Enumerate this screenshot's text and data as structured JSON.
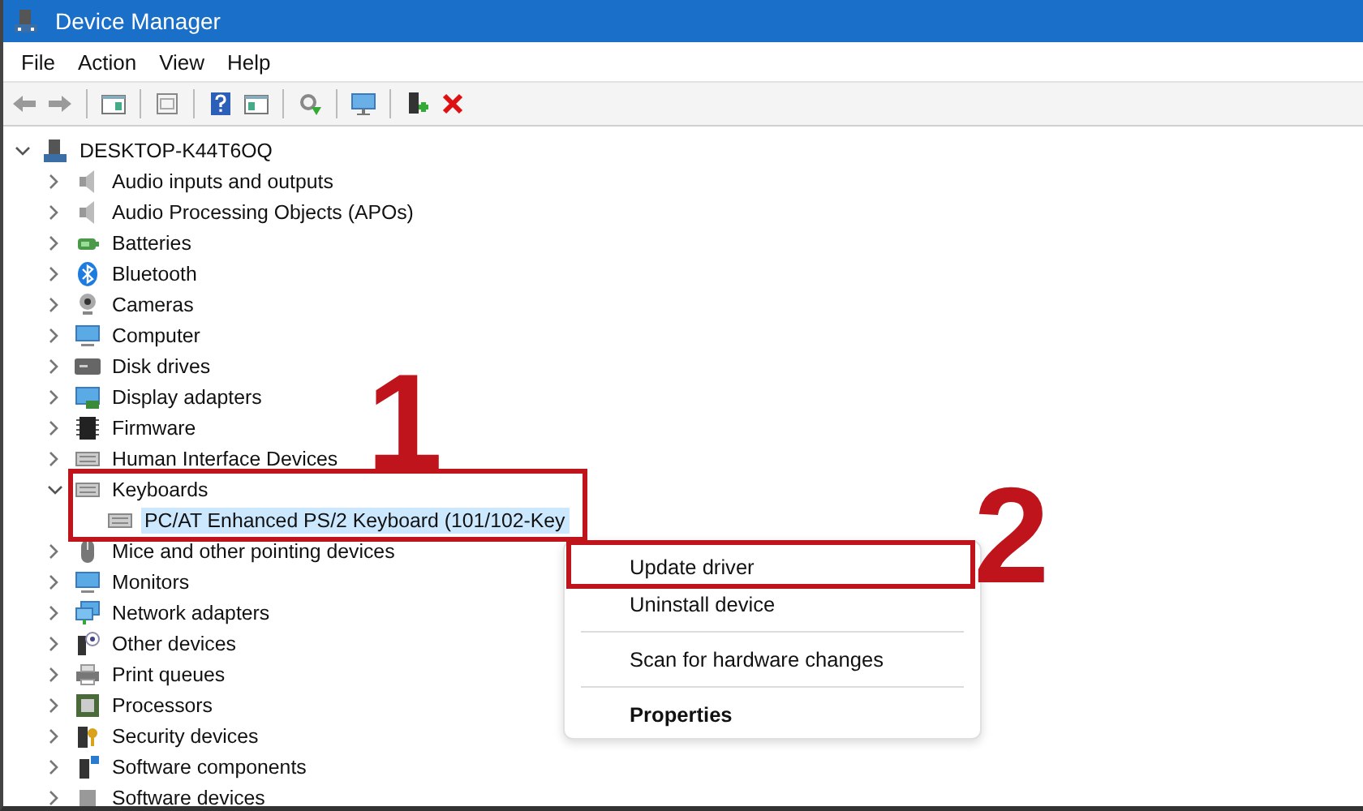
{
  "window": {
    "title": "Device Manager"
  },
  "menu": [
    "File",
    "Action",
    "View",
    "Help"
  ],
  "tree": {
    "label": "DESKTOP-K44T6OQ",
    "expanded": true,
    "selected": false,
    "children": [
      {
        "label": "Audio inputs and outputs",
        "expanded": false,
        "selected": false
      },
      {
        "label": "Audio Processing Objects (APOs)",
        "expanded": false,
        "selected": false
      },
      {
        "label": "Batteries",
        "expanded": false,
        "selected": false
      },
      {
        "label": "Bluetooth",
        "expanded": false,
        "selected": false
      },
      {
        "label": "Cameras",
        "expanded": false,
        "selected": false
      },
      {
        "label": "Computer",
        "expanded": false,
        "selected": false
      },
      {
        "label": "Disk drives",
        "expanded": false,
        "selected": false
      },
      {
        "label": "Display adapters",
        "expanded": false,
        "selected": false
      },
      {
        "label": "Firmware",
        "expanded": false,
        "selected": false
      },
      {
        "label": "Human Interface Devices",
        "expanded": false,
        "selected": false
      },
      {
        "label": "Keyboards",
        "expanded": true,
        "selected": false,
        "children": [
          {
            "label": "PC/AT Enhanced PS/2 Keyboard (101/102-Key",
            "selected": true
          }
        ]
      },
      {
        "label": "Mice and other pointing devices",
        "expanded": false,
        "selected": false
      },
      {
        "label": "Monitors",
        "expanded": false,
        "selected": false
      },
      {
        "label": "Network adapters",
        "expanded": false,
        "selected": false
      },
      {
        "label": "Other devices",
        "expanded": false,
        "selected": false
      },
      {
        "label": "Print queues",
        "expanded": false,
        "selected": false
      },
      {
        "label": "Processors",
        "expanded": false,
        "selected": false
      },
      {
        "label": "Security devices",
        "expanded": false,
        "selected": false
      },
      {
        "label": "Software components",
        "expanded": false,
        "selected": false
      },
      {
        "label": "Software devices",
        "expanded": false,
        "selected": false
      }
    ]
  },
  "context_menu": {
    "items": [
      {
        "kind": "item",
        "label": "Update driver"
      },
      {
        "kind": "item",
        "label": "Uninstall device"
      },
      {
        "kind": "separator"
      },
      {
        "kind": "item",
        "label": "Scan for hardware changes"
      },
      {
        "kind": "separator"
      },
      {
        "kind": "default",
        "label": "Properties"
      }
    ]
  },
  "annotations": [
    {
      "label": "1"
    },
    {
      "label": "2"
    }
  ]
}
